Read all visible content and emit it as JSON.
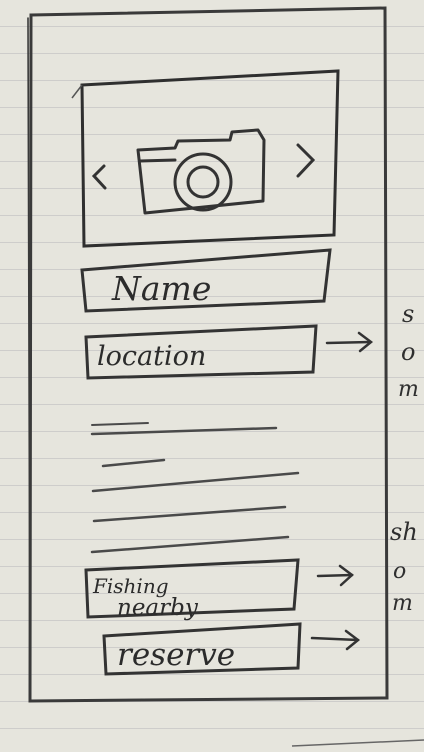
{
  "mockup": {
    "name_field": {
      "label": "Name"
    },
    "location_field": {
      "label": "location"
    },
    "fishing_nearby_button": {
      "line1": "Fishing",
      "line2": "nearby"
    },
    "reserve_button": {
      "label": "reserve"
    },
    "annotations": {
      "location_note": [
        "s",
        "o",
        "m"
      ],
      "fishing_note": [
        "sh",
        "o",
        "m"
      ]
    },
    "icons": {
      "camera": "camera-icon",
      "prev": "chevron-left-icon",
      "next": "chevron-right-icon",
      "arrow": "arrow-right-icon"
    },
    "colors": {
      "paper": "#e6e5dd",
      "pencil": "#2b2b2b"
    }
  }
}
